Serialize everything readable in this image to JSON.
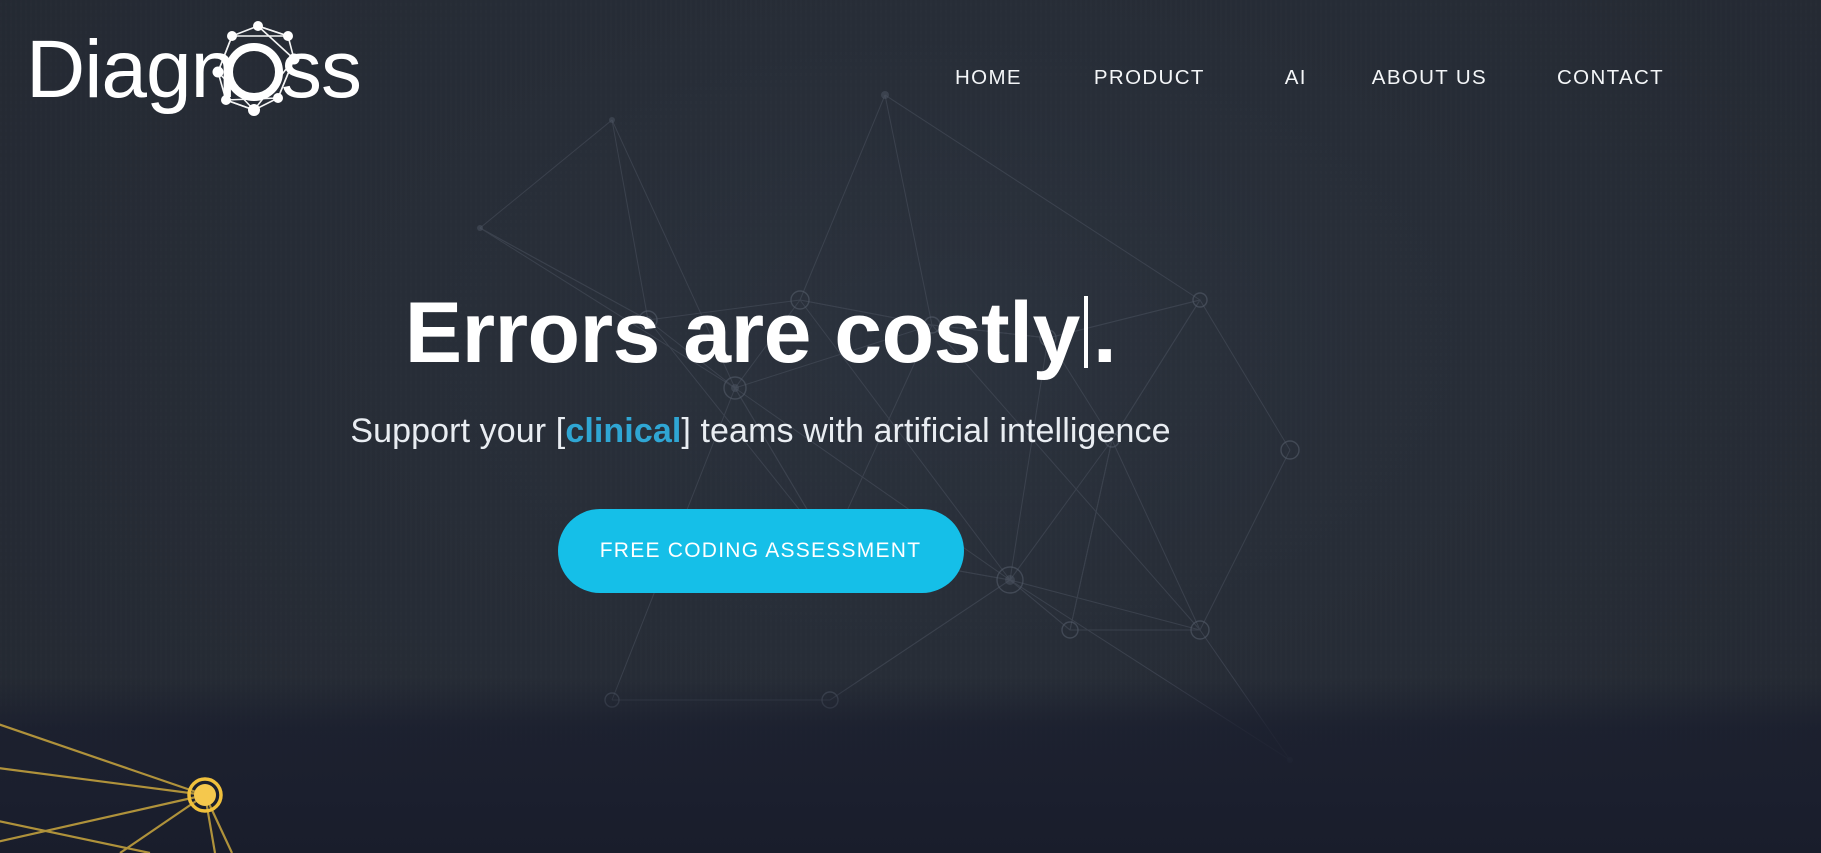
{
  "brand": {
    "name": "Diagnoss",
    "logo_icon": "network-nodes-icon"
  },
  "nav": {
    "items": [
      {
        "label": "HOME"
      },
      {
        "label": "PRODUCT"
      },
      {
        "label": "AI"
      },
      {
        "label": "ABOUT US"
      },
      {
        "label": "CONTACT"
      }
    ]
  },
  "hero": {
    "headline_text": "Errors are costly",
    "headline_suffix": ".",
    "caret": "|",
    "subhead_prefix": "Support your [",
    "subhead_highlight": "clinical",
    "subhead_suffix": "] teams with artificial intelligence",
    "cta_label": "FREE CODING ASSESSMENT"
  },
  "colors": {
    "background": "#252a33",
    "bottom_band": "#1b1f2e",
    "accent_cyan": "#15bfe8",
    "highlight_cyan": "#2fa6d4",
    "gold_node": "#f5c542",
    "text_white": "#ffffff"
  }
}
